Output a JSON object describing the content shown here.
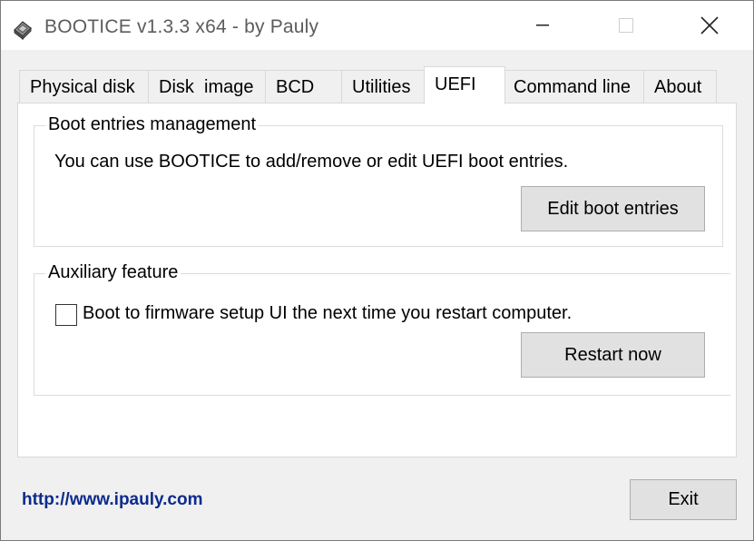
{
  "window": {
    "title": "BOOTICE v1.3.3 x64 - by Pauly"
  },
  "tabs": [
    {
      "label": "Physical disk"
    },
    {
      "label": "Disk  image"
    },
    {
      "label": "BCD"
    },
    {
      "label": "Utilities"
    },
    {
      "label": "UEFI"
    },
    {
      "label": "Command line"
    },
    {
      "label": "About"
    }
  ],
  "active_tab": "UEFI",
  "boot_entries": {
    "group_title": "Boot entries management",
    "description": "You can use BOOTICE to add/remove or edit UEFI boot entries.",
    "button_label": "Edit boot entries"
  },
  "auxiliary": {
    "group_title": "Auxiliary feature",
    "checkbox_label": "Boot to firmware setup UI the next time you restart computer.",
    "checkbox_checked": false,
    "button_label": "Restart now"
  },
  "footer": {
    "link_text": "http://www.ipauly.com",
    "exit_label": "Exit"
  },
  "icons": {
    "app": "bootice-drive-icon",
    "minimize": "minimize-icon",
    "maximize": "maximize-icon",
    "close": "close-icon"
  },
  "colors": {
    "link": "#0d2b8c",
    "button_face": "#e1e1e1",
    "window_face": "#f0f0f0"
  }
}
